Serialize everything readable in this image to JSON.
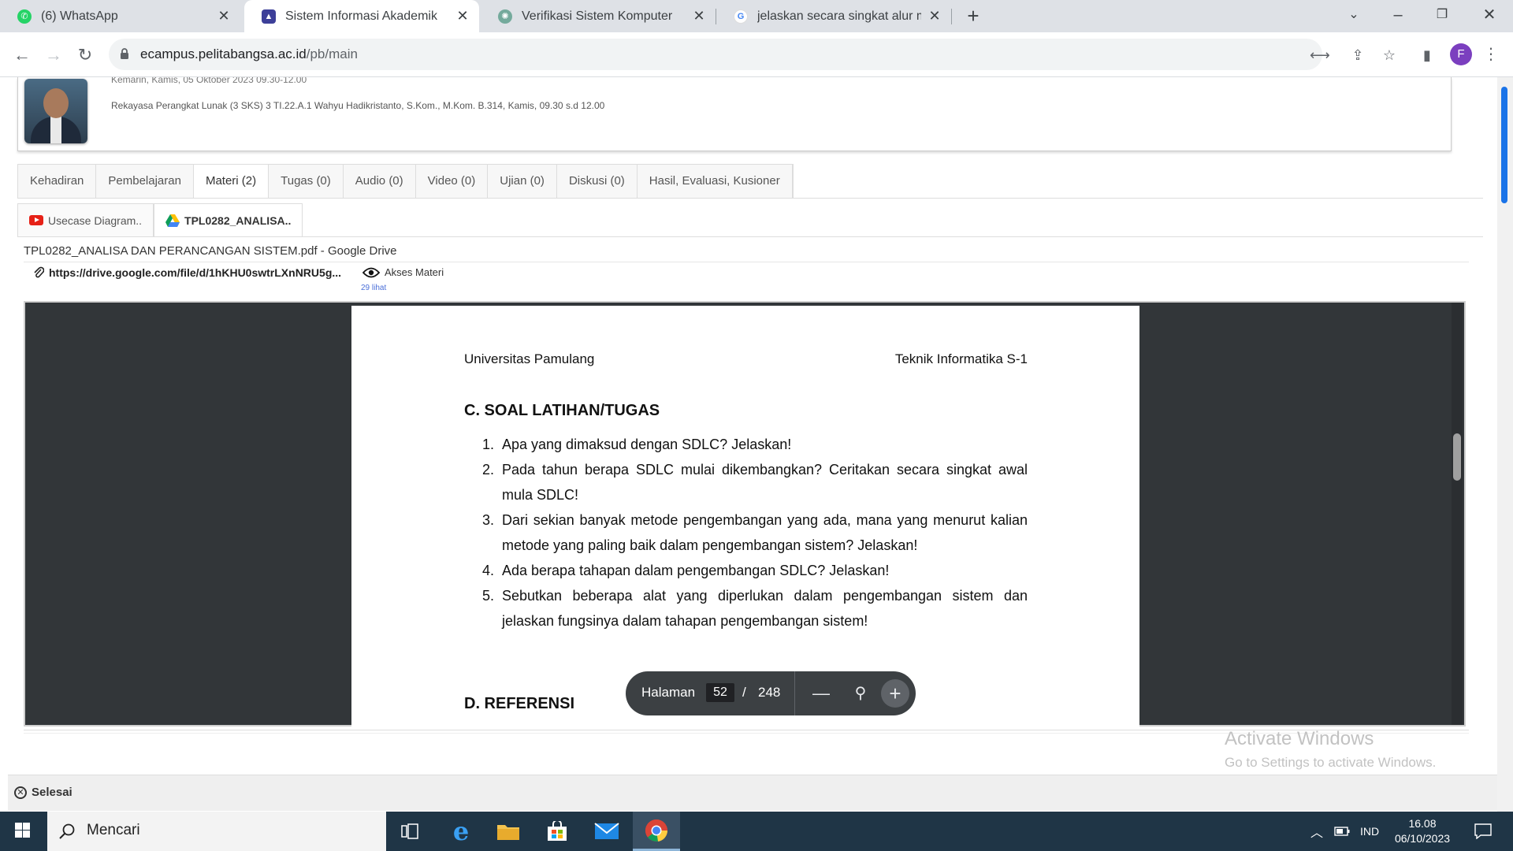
{
  "browser": {
    "tabs": [
      {
        "title": "(6) WhatsApp",
        "icon": "whatsapp-icon",
        "active": false
      },
      {
        "title": "Sistem Informasi Akademik",
        "icon": "campus-logo-icon",
        "active": true
      },
      {
        "title": "Verifikasi Sistem Komputer",
        "icon": "chatgpt-icon",
        "active": false
      },
      {
        "title": "jelaskan secara singkat alur meto",
        "icon": "google-icon",
        "active": false
      }
    ],
    "new_tab": "+",
    "url_host": "ecampus.pelitabangsa.ac.id",
    "url_path": "/pb/main",
    "profile_initial": "F"
  },
  "profile": {
    "course_line_1": "Kemarin, Kamis, 05 Oktober 2023 09.30-12.00",
    "course_line_2": "Rekayasa Perangkat Lunak (3 SKS) 3 TI.22.A.1 Wahyu Hadikristanto, S.Kom., M.Kom. B.314, Kamis, 09.30 s.d 12.00"
  },
  "tabs": [
    {
      "label": "Kehadiran",
      "active": false
    },
    {
      "label": "Pembelajaran",
      "active": false
    },
    {
      "label": "Materi (2)",
      "active": true
    },
    {
      "label": "Tugas (0)",
      "active": false
    },
    {
      "label": "Audio (0)",
      "active": false
    },
    {
      "label": "Video (0)",
      "active": false
    },
    {
      "label": "Ujian (0)",
      "active": false
    },
    {
      "label": "Diskusi (0)",
      "active": false
    },
    {
      "label": "Hasil, Evaluasi, Kusioner",
      "active": false
    }
  ],
  "materials": [
    {
      "label": "Usecase Diagram..",
      "icon": "youtube-icon",
      "active": false
    },
    {
      "label": "TPL0282_ANALISA..",
      "icon": "google-drive-icon",
      "active": true
    }
  ],
  "material": {
    "title": "TPL0282_ANALISA DAN PERANCANGAN SISTEM.pdf - Google Drive",
    "link": "https://drive.google.com/file/d/1hKHU0swtrLXnNRU5g...",
    "access_label": "Akses Materi",
    "views": "29 lihat"
  },
  "pdf": {
    "header_left": "Universitas Pamulang",
    "header_right": "Teknik Informatika S-1",
    "section_title": "C. SOAL LATIHAN/TUGAS",
    "items": [
      {
        "n": "1.",
        "text": "Apa yang dimaksud dengan SDLC? Jelaskan!"
      },
      {
        "n": "2.",
        "text": "Pada tahun berapa SDLC mulai dikembangkan? Ceritakan secara singkat awal mula SDLC!"
      },
      {
        "n": "3.",
        "text": "Dari sekian banyak metode pengembangan yang ada, mana yang menurut kalian metode yang paling baik dalam pengembangan sistem? Jelaskan!"
      },
      {
        "n": "4.",
        "text": "Ada berapa tahapan dalam pengembangan SDLC? Jelaskan!"
      },
      {
        "n": "5.",
        "text": "Sebutkan beberapa alat yang diperlukan dalam pengembangan sistem dan jelaskan fungsinya dalam tahapan pengembangan sistem!"
      }
    ],
    "section2_title": "D.  REFERENSI"
  },
  "pager": {
    "label": "Halaman",
    "current": "52",
    "separator": "/",
    "total": "248"
  },
  "watermark": {
    "line1": "Activate Windows",
    "line2": "Go to Settings to activate Windows."
  },
  "footer": {
    "done_label": "Selesai"
  },
  "taskbar": {
    "search_placeholder": "Mencari",
    "language": "IND",
    "time": "16.08",
    "date": "06/10/2023"
  }
}
